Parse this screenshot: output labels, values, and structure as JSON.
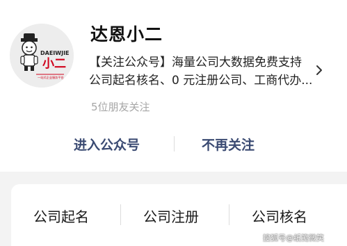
{
  "account": {
    "name": "达恩小二",
    "description": "【关注公众号】海量公司大数据免费支持公司起名核名、0 元注册公司、工商代办...",
    "friends_following": "5位朋友关注"
  },
  "actions": {
    "enter": "进入公众号",
    "unfollow": "不再关注"
  },
  "menu": {
    "items": [
      "公司起名",
      "公司注册",
      "公司核名"
    ]
  },
  "logo": {
    "brand_text": "DAEIWJIE",
    "brand_big": "小二",
    "tagline": "一站式企业服务平台"
  },
  "watermark": "搜狐号@纸笺微笑",
  "colors": {
    "action_text": "#3a4a72",
    "logo_red": "#d0021b",
    "background": "#f3f3f3"
  },
  "icons": {
    "more": "chevron-right-icon"
  }
}
